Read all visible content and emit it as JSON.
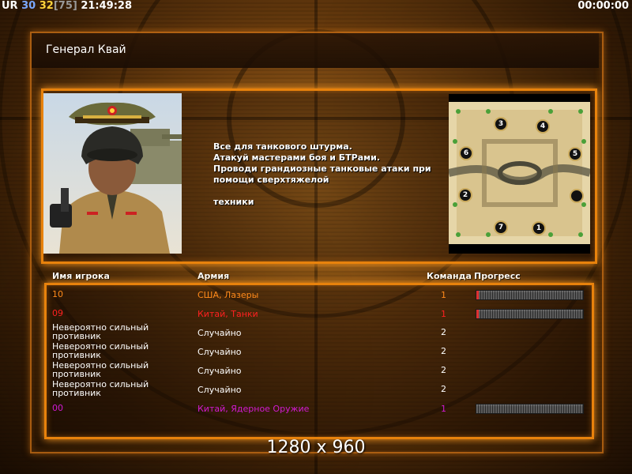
{
  "hud": {
    "ur_label": "UR",
    "ur_value": "30",
    "count_current": "32",
    "count_total": "[75]",
    "clock": "21:49:28",
    "timer": "00:00:00"
  },
  "general": {
    "name": "Генерал Квай"
  },
  "description": {
    "lines": [
      "Все для танкового штурма.",
      "Атакуй мастерами боя и БТРами.",
      "Проводи грандиозные танковые атаки при",
      " помощи сверхтяжелой",
      "",
      "техники"
    ]
  },
  "map": {
    "slots": [
      "3",
      "4",
      "6",
      "5",
      "2",
      "",
      "7",
      "1"
    ]
  },
  "table": {
    "headers": {
      "player": "Имя игрока",
      "army": "Армия",
      "team": "Команда",
      "progress": "Прогресс"
    },
    "rows": [
      {
        "name": "10",
        "army": "США, Лазеры",
        "team": "1",
        "color": "#ff8a1a",
        "progress": 0.02,
        "show_progress": true
      },
      {
        "name": "09",
        "army": "Китай, Танки",
        "team": "1",
        "color": "#ff2020",
        "progress": 0.02,
        "show_progress": true
      },
      {
        "name": "Невероятно сильный противник",
        "army": "Случайно",
        "team": "2",
        "color": "#ffffff",
        "progress": 0,
        "show_progress": false
      },
      {
        "name": "Невероятно сильный противник",
        "army": "Случайно",
        "team": "2",
        "color": "#ffffff",
        "progress": 0,
        "show_progress": false
      },
      {
        "name": "Невероятно сильный противник",
        "army": "Случайно",
        "team": "2",
        "color": "#ffffff",
        "progress": 0,
        "show_progress": false
      },
      {
        "name": "Невероятно сильный противник",
        "army": "Случайно",
        "team": "2",
        "color": "#ffffff",
        "progress": 0,
        "show_progress": false
      },
      {
        "name": "00",
        "army": "Китай, Ядерное Оружие",
        "team": "1",
        "color": "#d21ad2",
        "progress": 0,
        "show_progress": true
      }
    ]
  },
  "resolution": "1280 x 960"
}
